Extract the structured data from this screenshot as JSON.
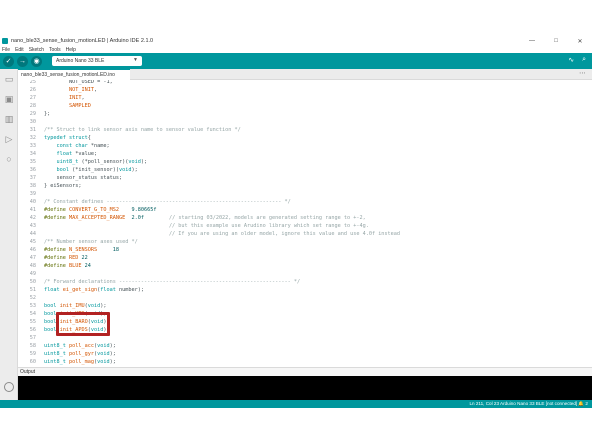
{
  "window": {
    "title": "nano_ble33_sense_fusion_motionLED | Arduino IDE 2.1.0",
    "controls": [
      "—",
      "□",
      "✕"
    ]
  },
  "menu": [
    "File",
    "Edit",
    "Sketch",
    "Tools",
    "Help"
  ],
  "toolbar": {
    "verify_icon": "✓",
    "upload_icon": "→",
    "debug_icon": "◉",
    "board": "Arduino Nano 33 BLE",
    "board_caret": "▼",
    "serial_plotter_icon": "∿",
    "serial_monitor_icon": "⌕"
  },
  "tab": {
    "label": "nano_ble33_sense_fusion_motionLED.ino",
    "more": "⋯"
  },
  "sidebar_icons": [
    "folder-icon",
    "board-icon",
    "library-icon",
    "debug-icon",
    "search-icon"
  ],
  "code_lines": [
    {
      "n": "25",
      "html": "        NOT_USED = -1,"
    },
    {
      "n": "26",
      "html": "        <span class='k-const'>NOT_INIT</span>,"
    },
    {
      "n": "27",
      "html": "        <span class='k-const'>INIT</span>,"
    },
    {
      "n": "28",
      "html": "        <span class='k-const'>SAMPLED</span>"
    },
    {
      "n": "29",
      "html": "};"
    },
    {
      "n": "30",
      "html": ""
    },
    {
      "n": "31",
      "html": "<span class='k-cmt'>/** Struct to link sensor axis name to sensor value function */</span>"
    },
    {
      "n": "32",
      "html": "<span class='k-type'>typedef</span> <span class='k-type'>struct</span>{"
    },
    {
      "n": "33",
      "html": "    <span class='k-type'>const</span> <span class='k-type'>char</span> *name;"
    },
    {
      "n": "34",
      "html": "    <span class='k-type'>float</span> *value;"
    },
    {
      "n": "35",
      "html": "    <span class='k-type'>uint8_t</span> (*poll_sensor)(<span class='k-type'>void</span>);"
    },
    {
      "n": "36",
      "html": "    <span class='k-type'>bool</span> (*init_sensor)(<span class='k-type'>void</span>);"
    },
    {
      "n": "37",
      "html": "    sensor_status status;"
    },
    {
      "n": "38",
      "html": "} eiSensors;"
    },
    {
      "n": "39",
      "html": ""
    },
    {
      "n": "40",
      "html": "<span class='k-cmt'>/* Constant defines -------------------------------------------------------- */</span>"
    },
    {
      "n": "41",
      "html": "<span class='k-pre'>#define</span> <span class='k-const'>CONVERT_G_TO_MS2</span>    <span class='k-num'>9.80665f</span>"
    },
    {
      "n": "42",
      "html": "<span class='k-pre'>#define</span> <span class='k-const'>MAX_ACCEPTED_RANGE</span>  <span class='k-num'>2.0f</span>        <span class='k-cmt'>// starting 03/2022, models are generated setting range to +-2,</span>"
    },
    {
      "n": "43",
      "html": "                                        <span class='k-cmt'>// but this example use Arudino library which set range to +-4g.</span>"
    },
    {
      "n": "44",
      "html": "                                        <span class='k-cmt'>// If you are using an older model, ignore this value and use 4.0f instead</span>"
    },
    {
      "n": "45",
      "html": "<span class='k-cmt'>/** Number sensor axes used */</span>"
    },
    {
      "n": "46",
      "html": "<span class='k-pre'>#define</span> <span class='k-const'>N_SENSORS</span>     <span class='k-num'>18</span>"
    },
    {
      "n": "47",
      "html": "<span class='k-pre'>#define</span> <span class='k-const'>RED</span> <span class='k-num'>22</span>"
    },
    {
      "n": "48",
      "html": "<span class='k-pre'>#define</span> <span class='k-const'>BLUE</span> <span class='k-num'>24</span>"
    },
    {
      "n": "49",
      "html": ""
    },
    {
      "n": "50",
      "html": "<span class='k-cmt'>/* Forward declarations ------------------------------------------------------- */</span>"
    },
    {
      "n": "51",
      "html": "<span class='k-type'>float</span> <span class='k-orange'>ei_get_sign</span>(<span class='k-type'>float</span> number);"
    },
    {
      "n": "52",
      "html": ""
    },
    {
      "n": "53",
      "html": "<span class='k-type'>bool</span> <span class='k-orange'>init_IMU</span>(<span class='k-type'>void</span>);"
    },
    {
      "n": "54",
      "html": "<span class='k-type'>bool</span> <span class='k-orange'>init_HTS</span>(<span class='k-type'>void</span>);"
    },
    {
      "n": "55",
      "html": "<span class='k-type'>bool</span> <span class='k-orange'>init_BARO</span>(<span class='k-type'>void</span>);"
    },
    {
      "n": "56",
      "html": "<span class='k-type'>bool</span> <span class='k-orange'>init_APDS</span>(<span class='k-type'>void</span>);"
    },
    {
      "n": "57",
      "html": ""
    },
    {
      "n": "58",
      "html": "<span class='k-type'>uint8_t</span> <span class='k-orange'>poll_acc</span>(<span class='k-type'>void</span>);"
    },
    {
      "n": "59",
      "html": "<span class='k-type'>uint8_t</span> <span class='k-orange'>poll_gyr</span>(<span class='k-type'>void</span>);"
    },
    {
      "n": "60",
      "html": "<span class='k-type'>uint8_t</span> <span class='k-orange'>poll_mag</span>(<span class='k-type'>void</span>);"
    },
    {
      "n": "61",
      "html": "<span class='k-type'>uint8_t</span> <span class='k-orange'>poll_HTS</span>(<span class='k-type'>void</span>);"
    },
    {
      "n": "62",
      "html": "<span class='k-type'>uint8_t</span> <span class='k-orange'>poll_BARO</span>(<span class='k-type'>void</span>);"
    },
    {
      "n": "63",
      "html": "<span class='k-type'>uint8_t</span> <span class='k-orange'>poll_APDS_color</span>(<span class='k-type'>void</span>);"
    },
    {
      "n": "64",
      "html": "<span class='k-type'>uint8_t</span> <span class='k-orange'>poll_APDS_proximity</span>(<span class='k-type'>void</span>);"
    }
  ],
  "output": {
    "label": "Output"
  },
  "status": {
    "text": "Ln 211, Col 23   Arduino Nano 33 BLE [not connected]   🔔 2"
  },
  "colors": {
    "accent": "#00979d",
    "highlight_box": "#b22222"
  }
}
